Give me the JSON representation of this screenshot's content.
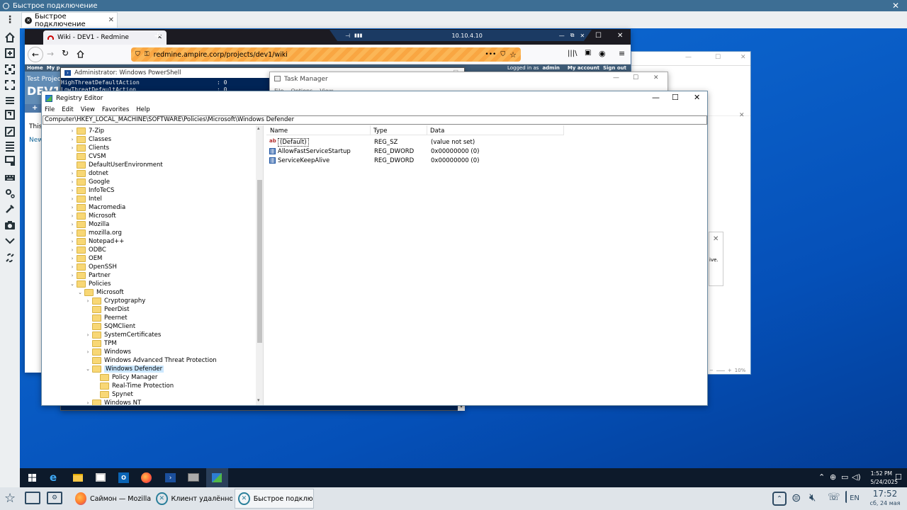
{
  "client": {
    "title": "Быстрое подключение",
    "tab_label": "Быстрое подключение"
  },
  "firefox": {
    "tab_title": "Wiki - DEV1 - Redmine",
    "url": "redmine.ampire.corp/projects/dev1/wiki",
    "rdp_host": "10.10.4.10",
    "redmine": {
      "menu_home": "Home",
      "menu_my": "My p",
      "logged_in_prefix": "Logged in as",
      "user": "admin",
      "my_account": "My account",
      "sign_out": "Sign out",
      "project_parent": "Test Projec",
      "project_name": "DEV1",
      "plus": "+",
      "body_text": "This",
      "new_link": "New"
    }
  },
  "powershell": {
    "title": "Administrator: Windows PowerShell",
    "lines": [
      {
        "key": "HighThreatDefaultAction",
        "value": ": 0"
      },
      {
        "key": "LowThreatDefaultAction",
        "value": ": 0"
      }
    ]
  },
  "task_manager": {
    "title": "Task Manager",
    "menu": [
      "File",
      "Options",
      "View"
    ]
  },
  "regedit": {
    "title": "Registry Editor",
    "menu": [
      "File",
      "Edit",
      "View",
      "Favorites",
      "Help"
    ],
    "address": "Computer\\HKEY_LOCAL_MACHINE\\SOFTWARE\\Policies\\Microsoft\\Windows Defender",
    "columns": {
      "name": "Name",
      "type": "Type",
      "data": "Data"
    },
    "values": [
      {
        "icon": "string-value-icon",
        "name": "(Default)",
        "type": "REG_SZ",
        "data": "(value not set)"
      },
      {
        "icon": "binary-value-icon",
        "name": "AllowFastServiceStartup",
        "type": "REG_DWORD",
        "data": "0x00000000 (0)"
      },
      {
        "icon": "binary-value-icon",
        "name": "ServiceKeepAlive",
        "type": "REG_DWORD",
        "data": "0x00000000 (0)"
      }
    ],
    "tree": [
      {
        "label": "7-Zip",
        "level": 0,
        "arrow": "›"
      },
      {
        "label": "Classes",
        "level": 0,
        "arrow": "›"
      },
      {
        "label": "Clients",
        "level": 0,
        "arrow": "›"
      },
      {
        "label": "CVSM",
        "level": 0,
        "arrow": ""
      },
      {
        "label": "DefaultUserEnvironment",
        "level": 0,
        "arrow": ""
      },
      {
        "label": "dotnet",
        "level": 0,
        "arrow": "›"
      },
      {
        "label": "Google",
        "level": 0,
        "arrow": "›"
      },
      {
        "label": "InfoTeCS",
        "level": 0,
        "arrow": "›"
      },
      {
        "label": "Intel",
        "level": 0,
        "arrow": "›"
      },
      {
        "label": "Macromedia",
        "level": 0,
        "arrow": "›"
      },
      {
        "label": "Microsoft",
        "level": 0,
        "arrow": "›"
      },
      {
        "label": "Mozilla",
        "level": 0,
        "arrow": "›"
      },
      {
        "label": "mozilla.org",
        "level": 0,
        "arrow": "›"
      },
      {
        "label": "Notepad++",
        "level": 0,
        "arrow": "›"
      },
      {
        "label": "ODBC",
        "level": 0,
        "arrow": "›"
      },
      {
        "label": "OEM",
        "level": 0,
        "arrow": "›"
      },
      {
        "label": "OpenSSH",
        "level": 0,
        "arrow": "›"
      },
      {
        "label": "Partner",
        "level": 0,
        "arrow": "›"
      },
      {
        "label": "Policies",
        "level": 0,
        "arrow": "⌄"
      },
      {
        "label": "Microsoft",
        "level": 1,
        "arrow": "⌄"
      },
      {
        "label": "Cryptography",
        "level": 2,
        "arrow": "›"
      },
      {
        "label": "PeerDist",
        "level": 2,
        "arrow": ""
      },
      {
        "label": "Peernet",
        "level": 2,
        "arrow": ""
      },
      {
        "label": "SQMClient",
        "level": 2,
        "arrow": ""
      },
      {
        "label": "SystemCertificates",
        "level": 2,
        "arrow": "›"
      },
      {
        "label": "TPM",
        "level": 2,
        "arrow": ""
      },
      {
        "label": "Windows",
        "level": 2,
        "arrow": "›"
      },
      {
        "label": "Windows Advanced Threat Protection",
        "level": 2,
        "arrow": ""
      },
      {
        "label": "Windows Defender",
        "level": 2,
        "arrow": "⌄",
        "selected": true
      },
      {
        "label": "Policy Manager",
        "level": 3,
        "arrow": ""
      },
      {
        "label": "Real-Time Protection",
        "level": 3,
        "arrow": ""
      },
      {
        "label": "Spynet",
        "level": 3,
        "arrow": ""
      },
      {
        "label": "Windows NT",
        "level": 2,
        "arrow": "›"
      }
    ]
  },
  "bg_window": {
    "text_fragment": "ive.",
    "zoom": "10%"
  },
  "win_taskbar": {
    "time": "1:52 PM",
    "date": "5/24/2025"
  },
  "local_taskbar": {
    "tasks": [
      {
        "label": "Саймон — Mozilla ...",
        "icon": "firefox-icon"
      },
      {
        "label": "Клиент удалённо...",
        "icon": "remote-client-icon"
      },
      {
        "label": "Быстрое подклю...",
        "icon": "remote-client-icon",
        "active": true
      }
    ],
    "lang": "EN",
    "time": "17:52",
    "date": "сб, 24 мая"
  },
  "colors": {
    "client_titlebar": "#3d6e94",
    "desktop": "#0a5fc8",
    "firefox_accent": "#f9a642",
    "redmine_header": "#628db6",
    "powershell_bg": "#012456",
    "selection": "#cce8ff"
  }
}
